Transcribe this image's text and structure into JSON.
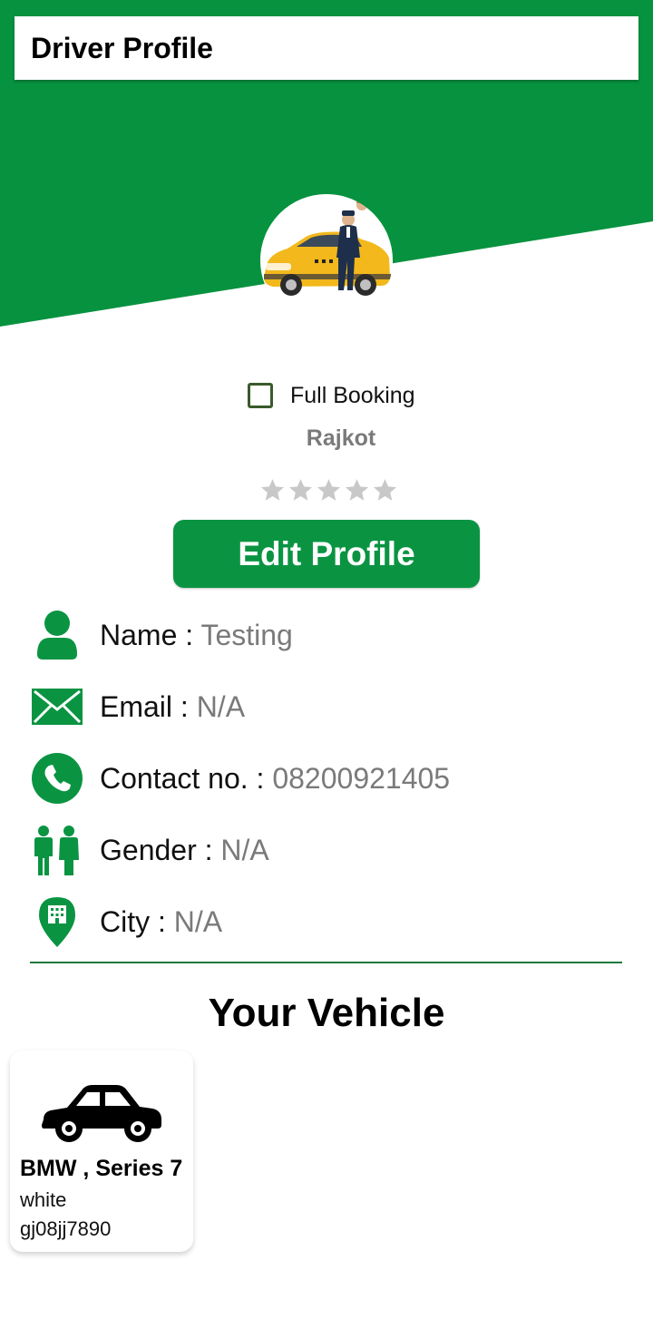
{
  "header": {
    "title": "Driver Profile"
  },
  "colors": {
    "brand_green": "#0a9442",
    "value_gray": "#7a7a7a",
    "star_gray": "#c8c8c8"
  },
  "profile": {
    "full_booking_label": "Full Booking",
    "full_booking_checked": false,
    "city": "Rajkot",
    "rating": 0,
    "rating_max": 5,
    "edit_button": "Edit Profile"
  },
  "info": {
    "name_label": "Name : ",
    "name_value": "Testing",
    "email_label": "Email : ",
    "email_value": "N/A",
    "contact_label": "Contact no. : ",
    "contact_value": "08200921405",
    "gender_label": "Gender : ",
    "gender_value": "N/A",
    "city_label": "City : ",
    "city_value": "N/A"
  },
  "vehicle_section": {
    "title": "Your Vehicle",
    "vehicles": [
      {
        "name": "BMW , Series 7",
        "color": "white",
        "plate": "gj08jj7890"
      }
    ]
  },
  "icons": {
    "avatar": "taxi-driver-avatar",
    "name": "person-icon",
    "email": "envelope-icon",
    "contact": "phone-icon",
    "gender": "gender-icon",
    "city": "city-pin-icon",
    "vehicle": "car-icon",
    "star": "star-icon"
  }
}
